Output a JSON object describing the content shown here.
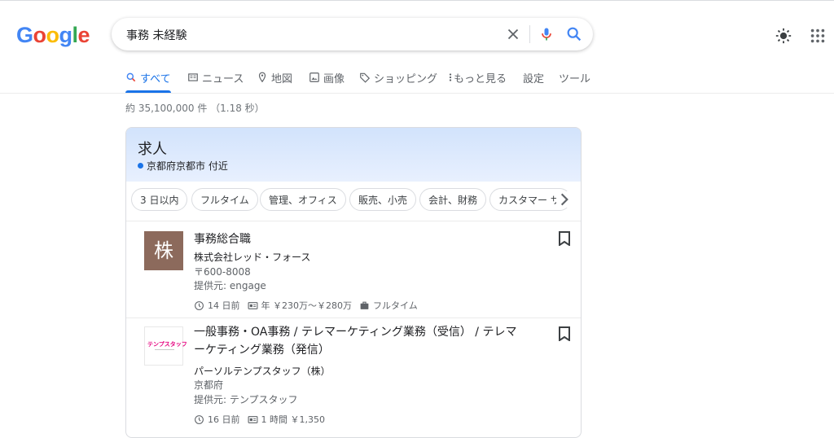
{
  "logo": {
    "letters": [
      "G",
      "o",
      "o",
      "g",
      "l",
      "e"
    ]
  },
  "search": {
    "query": "事務 未経験"
  },
  "tabs": [
    {
      "label": "すべて",
      "icon": "search-icon"
    },
    {
      "label": "ニュース",
      "icon": "news-icon"
    },
    {
      "label": "地図",
      "icon": "map-pin-icon"
    },
    {
      "label": "画像",
      "icon": "image-icon"
    },
    {
      "label": "ショッピング",
      "icon": "tag-icon"
    },
    {
      "label": "もっと見る",
      "icon": "more-vert-icon"
    },
    {
      "label": "設定"
    },
    {
      "label": "ツール"
    }
  ],
  "stats": "約 35,100,000 件 （1.18 秒）",
  "jobs_card": {
    "title": "求人",
    "location": "京都府京都市 付近",
    "chips": [
      "3 日以内",
      "フルタイム",
      "管理、オフィス",
      "販売、小売",
      "会計、財務",
      "カスタマー サ"
    ],
    "items": [
      {
        "logo_text": "株",
        "title": "事務総合職",
        "company": "株式会社レッド・フォース",
        "location": "〒600-8008",
        "via": "提供元: engage",
        "posted": "14 日前",
        "salary": "年 ￥230万～￥280万",
        "type": "フルタイム"
      },
      {
        "logo_text": "テンプスタッフ",
        "title": "一般事務・OA事務 / テレマーケティング業務（受信） / テレマーケティング業務（発信）",
        "company": "パーソルテンプスタッフ（株）",
        "location": "京都府",
        "via": "提供元: テンプスタッフ",
        "posted": "16 日前",
        "salary": "1 時間 ￥1,350"
      }
    ]
  },
  "colors": {
    "blue": "#4285F4",
    "red": "#EA4335",
    "yellow": "#FBBC05",
    "green": "#34A853",
    "accent": "#1a73e8"
  }
}
